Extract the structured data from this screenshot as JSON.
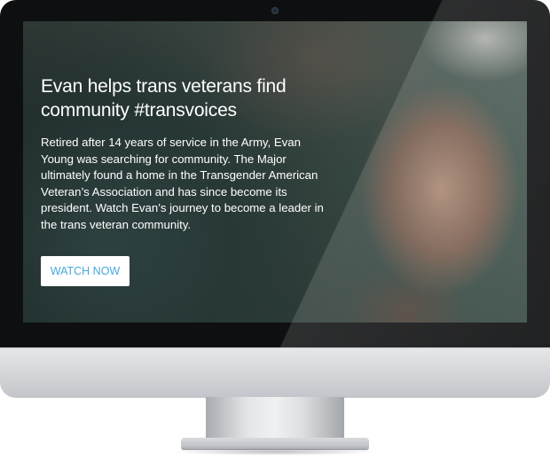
{
  "hero": {
    "title": "Evan helps trans veterans find community #transvoices",
    "description": "Retired after 14 years of service in the Army, Evan Young was searching for community. The Major ultimately found a home in the Transgender American Veteran’s Association and has since become its president. Watch Evan’s journey to become a leader in the trans veteran community.",
    "cta_label": "WATCH NOW"
  },
  "colors": {
    "cta_text": "#47a8dc",
    "cta_background": "#ffffff",
    "hero_text": "#ffffff",
    "bezel": "#0e0f10"
  },
  "media": {
    "background_image": "photo of a man in a cap shading his eyes"
  }
}
